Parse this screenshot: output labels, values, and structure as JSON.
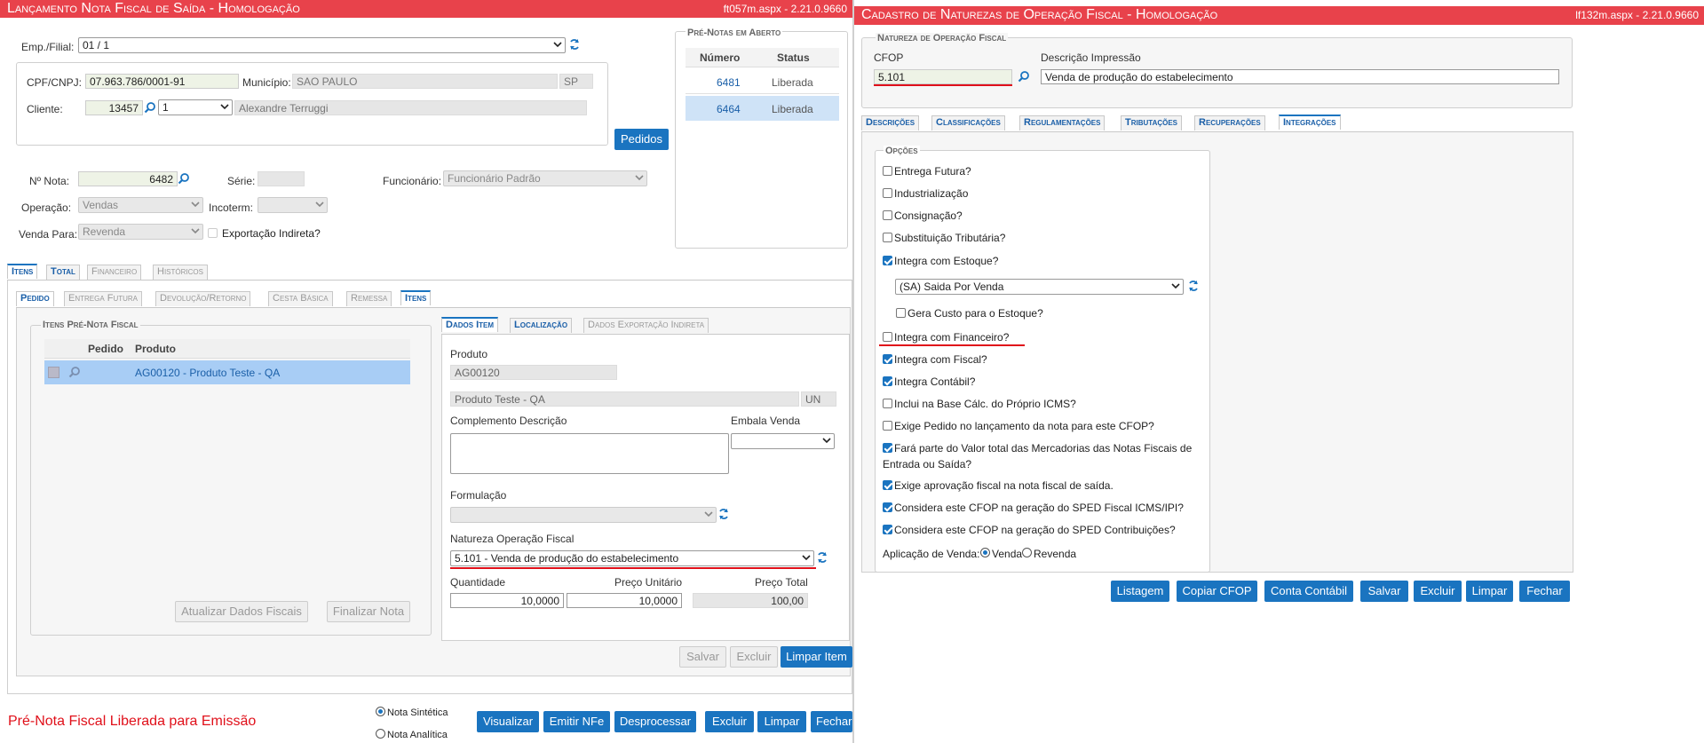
{
  "left": {
    "title": "Lançamento Nota Fiscal de Saída - Homologação",
    "page_info": "ft057m.aspx - 2.21.0.9660",
    "header": {
      "emp_filial_label": "Emp./Filial:",
      "emp_filial_value": "01 / 1",
      "cpf_label": "CPF/CNPJ:",
      "cpf_value": "07.963.786/0001-91",
      "municipio_label": "Município:",
      "municipio_value": "SAO PAULO",
      "uf_value": "SP",
      "cliente_label": "Cliente:",
      "cliente_code": "13457",
      "cliente_seq": "1",
      "cliente_name": "Alexandre Terruggi",
      "pedidos_button": "Pedidos",
      "nota_label": "Nº Nota:",
      "nota_value": "6482",
      "serie_label": "Série:",
      "funcionario_label": "Funcionário:",
      "funcionario_value": "Funcionário Padrão",
      "operacao_label": "Operação:",
      "operacao_value": "Vendas",
      "incoterm_label": "Incoterm:",
      "venda_para_label": "Venda Para:",
      "venda_para_value": "Revenda",
      "exportacao_label": "Exportação Indireta?"
    },
    "pre_notas": {
      "legend": "Pré-Notas em Aberto",
      "col_numero": "Número",
      "col_status": "Status",
      "rows": [
        {
          "numero": "6481",
          "status": "Liberada"
        },
        {
          "numero": "6464",
          "status": "Liberada"
        }
      ]
    },
    "main_tabs": [
      "Itens",
      "Total",
      "Financeiro",
      "Históricos"
    ],
    "sub_tabs": [
      "Pedido",
      "Entrega Futura",
      "Devolução/Retorno",
      "Cesta Básica",
      "Remessa",
      "Itens"
    ],
    "itens_panel": {
      "legend": "Itens Pré-Nota Fiscal",
      "col_pedido": "Pedido",
      "col_produto": "Produto",
      "row_produto": "AG00120 - Produto Teste - QA",
      "atualizar_button": "Atualizar Dados Fiscais",
      "finalizar_button": "Finalizar Nota"
    },
    "item_tabs": [
      "Dados Item",
      "Localização",
      "Dados Exportação Indireta"
    ],
    "dados_item": {
      "produto_label": "Produto",
      "produto_code": "AG00120",
      "produto_desc": "Produto Teste - QA",
      "unidade": "UN",
      "complemento_label": "Complemento Descrição",
      "embala_label": "Embala Venda",
      "formulacao_label": "Formulação",
      "natureza_label": "Natureza Operação Fiscal",
      "natureza_value": "5.101 - Venda de produção do estabelecimento",
      "quantidade_label": "Quantidade",
      "quantidade_value": "10,0000",
      "preco_unit_label": "Preço Unitário",
      "preco_unit_value": "10,0000",
      "preco_total_label": "Preço Total",
      "preco_total_value": "100,00",
      "salvar_button": "Salvar",
      "excluir_button": "Excluir",
      "limpar_item_button": "Limpar Item"
    },
    "footer": {
      "status_message": "Pré-Nota Fiscal Liberada para Emissão",
      "radio_sintetica": "Nota Sintética",
      "radio_analitica": "Nota Analítica",
      "buttons": [
        "Visualizar",
        "Emitir NFe",
        "Desprocessar",
        "Excluir",
        "Limpar",
        "Fechar"
      ]
    }
  },
  "right": {
    "title": "Cadastro de Naturezas de Operação Fiscal - Homologação",
    "page_info": "lf132m.aspx - 2.21.0.9660",
    "natureza": {
      "legend": "Natureza de Operação Fiscal",
      "cfop_label": "CFOP",
      "cfop_value": "5.101",
      "descricao_label": "Descrição Impressão",
      "descricao_value": "Venda de produção do estabelecimento"
    },
    "tabs": [
      "Descrições",
      "Classificações",
      "Regulamentações",
      "Tributações",
      "Recuperações",
      "Integrações"
    ],
    "opcoes": {
      "legend": "Opções",
      "entrega_futura": "Entrega Futura?",
      "industrializacao": "Industrialização",
      "consignacao": "Consignação?",
      "substituicao": "Substituição Tributária?",
      "integra_estoque": "Integra com Estoque?",
      "estoque_select": "(SA) Saida Por Venda",
      "gera_custo": "Gera Custo para o Estoque?",
      "integra_financeiro": "Integra com Financeiro?",
      "integra_fiscal": "Integra com Fiscal?",
      "integra_contabil": "Integra Contábil?",
      "inclui_base": "Inclui na Base Cálc. do Próprio ICMS?",
      "exige_pedido": "Exige Pedido no lançamento da nota para este CFOP?",
      "fara_parte_1": "Fará parte do Valor total das Mercadorias das Notas Fiscais de",
      "fara_parte_2": "Entrada ou Saída?",
      "exige_aprovacao": "Exige aprovação fiscal na nota fiscal de saída.",
      "sped_fiscal": "Considera este CFOP na geração do SPED Fiscal ICMS/IPI?",
      "sped_contrib": "Considera este CFOP na geração do SPED Contribuições?",
      "aplicacao_label": "Aplicação de Venda:",
      "aplicacao_venda": "Venda",
      "aplicacao_revenda": "Revenda"
    },
    "buttons": [
      "Listagem",
      "Copiar CFOP",
      "Conta Contábil",
      "Salvar",
      "Excluir",
      "Limpar",
      "Fechar"
    ]
  },
  "colors": {
    "title_bar": "#e8424b",
    "accent": "#1a74c0",
    "annotation": "#e0101a",
    "selected_row": "#cfe3f7"
  }
}
